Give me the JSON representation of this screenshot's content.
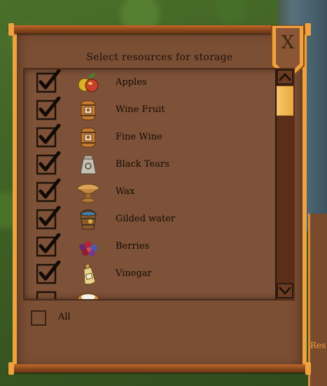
{
  "dialog": {
    "title": "Select resources for storage",
    "close_label": "X",
    "all_label": "All",
    "all_checked": false
  },
  "resources": [
    {
      "label": "Apples",
      "checked": true,
      "icon": "apple-icon"
    },
    {
      "label": "Wine Fruit",
      "checked": true,
      "icon": "wine-barrel-icon"
    },
    {
      "label": "Fine Wine",
      "checked": true,
      "icon": "wine-barrel-icon"
    },
    {
      "label": "Black Tears",
      "checked": true,
      "icon": "sack-icon"
    },
    {
      "label": "Wax",
      "checked": true,
      "icon": "wax-bowl-icon"
    },
    {
      "label": "Gilded water",
      "checked": true,
      "icon": "bucket-icon"
    },
    {
      "label": "Berries",
      "checked": true,
      "icon": "berries-icon"
    },
    {
      "label": "Vinegar",
      "checked": true,
      "icon": "bottle-icon"
    }
  ],
  "background": {
    "panel_text": "Res"
  },
  "colors": {
    "panel": "#7b4f34",
    "frame_accent": "#f0a23e",
    "scroll_thumb": "#f6c66b",
    "text": "#140b05"
  }
}
